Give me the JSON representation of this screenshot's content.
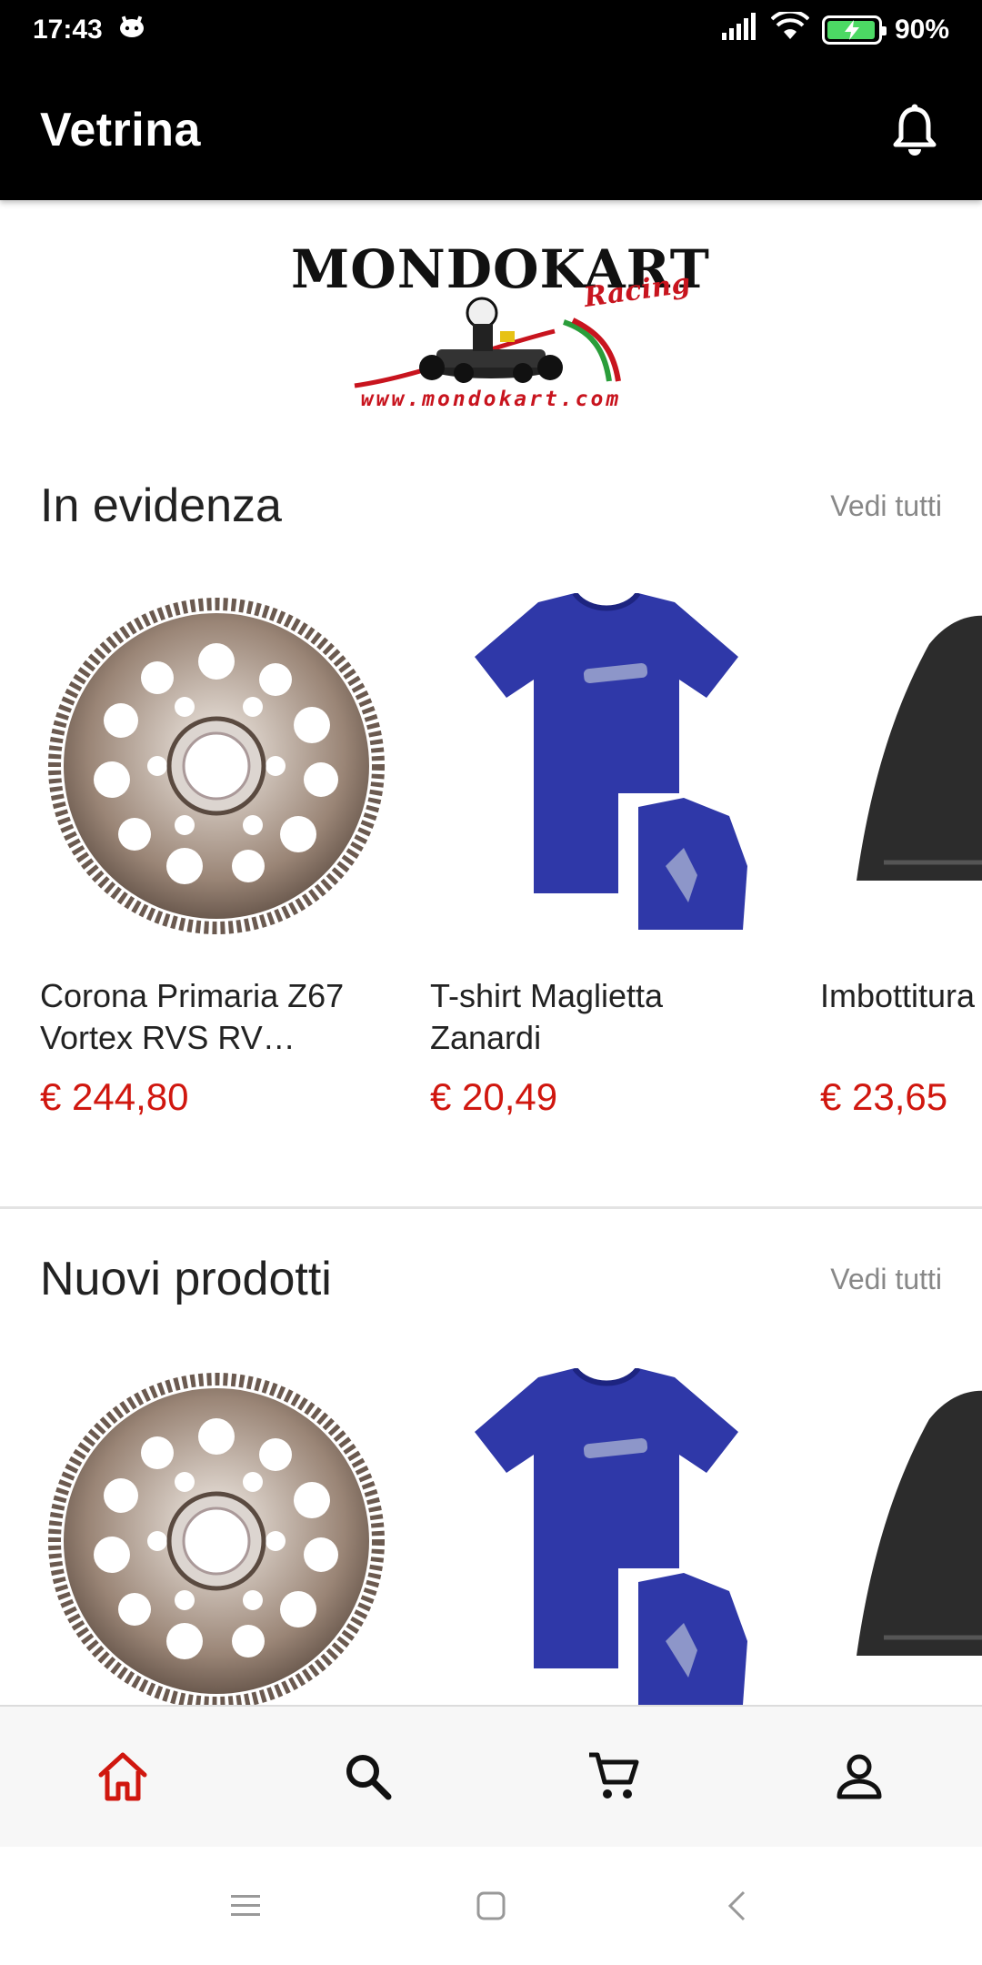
{
  "status_bar": {
    "time": "17:43",
    "battery": "90%",
    "battery_level": 0.9
  },
  "app_bar": {
    "title": "Vetrina",
    "notification_icon": "bell-icon"
  },
  "logo": {
    "title": "MONDOKART",
    "subtitle": "Racing",
    "url": "www.mondokart.com"
  },
  "sections": [
    {
      "title": "In evidenza",
      "see_all": "Vedi tutti",
      "products": [
        {
          "name": "Corona Primaria Z67 Vortex RVS RV…",
          "price": "€ 244,80",
          "image": "gear-sprocket"
        },
        {
          "name": "T-shirt Maglietta Zanardi",
          "price": "€ 20,49",
          "image": "blue-tshirt"
        },
        {
          "name": "Imbottitura Laterale A",
          "price": "€ 23,65",
          "image": "black-padding"
        }
      ]
    },
    {
      "title": "Nuovi prodotti",
      "see_all": "Vedi tutti",
      "products": [
        {
          "name": "",
          "price": "",
          "image": "gear-sprocket"
        },
        {
          "name": "",
          "price": "",
          "image": "blue-tshirt"
        },
        {
          "name": "",
          "price": "",
          "image": "black-padding"
        }
      ]
    }
  ],
  "bottom_nav": [
    {
      "icon": "home-icon",
      "active": true
    },
    {
      "icon": "search-icon",
      "active": false
    },
    {
      "icon": "cart-icon",
      "active": false
    },
    {
      "icon": "account-icon",
      "active": false
    }
  ],
  "colors": {
    "accent": "#d0170f",
    "app_bar": "#000000",
    "nav_background": "#f7f7f7"
  }
}
